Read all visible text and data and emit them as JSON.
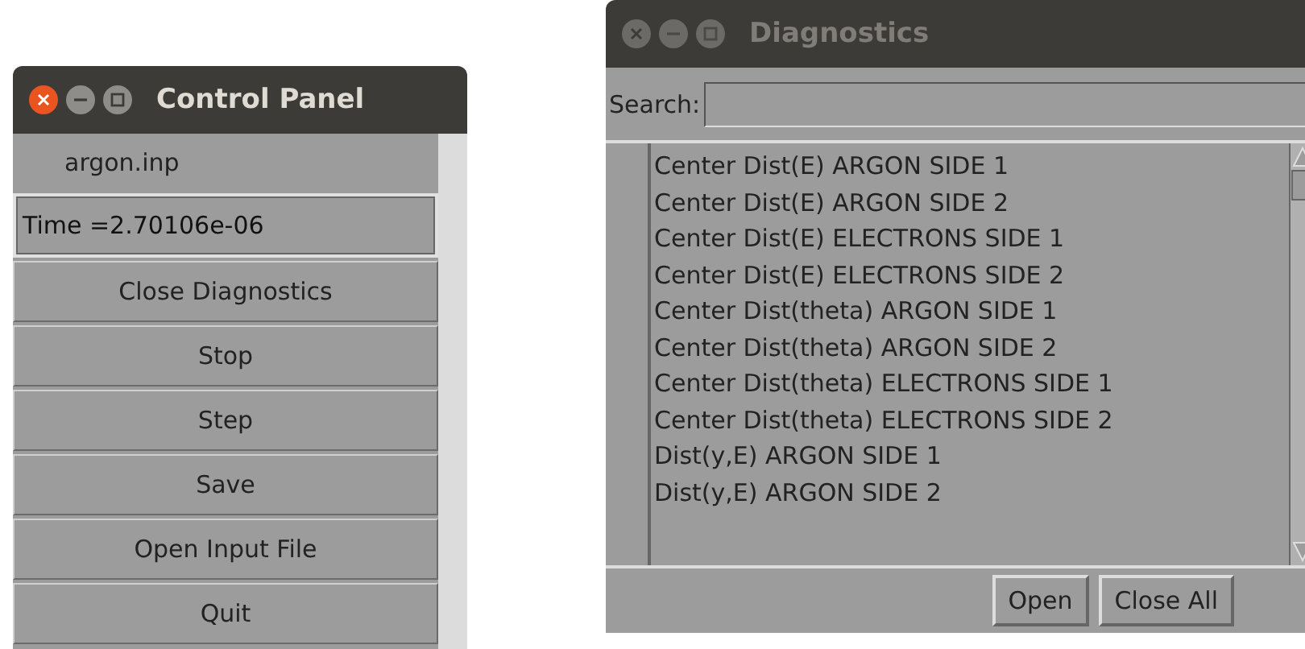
{
  "control_panel": {
    "title": "Control Panel",
    "active": true,
    "file_label": "argon.inp",
    "time_field": "Time =2.70106e-06",
    "buttons": [
      "Close Diagnostics",
      "Stop",
      "Step",
      "Save",
      "Open Input File",
      "Quit"
    ]
  },
  "diagnostics": {
    "title": "Diagnostics",
    "active": false,
    "search_label": "Search:",
    "items": [
      "Center Dist(E) ARGON SIDE 1",
      "Center Dist(E) ARGON SIDE 2",
      "Center Dist(E) ELECTRONS SIDE 1",
      "Center Dist(E) ELECTRONS SIDE 2",
      "Center Dist(theta) ARGON SIDE 1",
      "Center Dist(theta) ARGON SIDE 2",
      "Center Dist(theta) ELECTRONS SIDE 1",
      "Center Dist(theta) ELECTRONS SIDE 2",
      "Dist(y,E) ARGON SIDE 1",
      "Dist(y,E) ARGON SIDE 2"
    ],
    "buttons": [
      "Open",
      "Close All"
    ]
  }
}
